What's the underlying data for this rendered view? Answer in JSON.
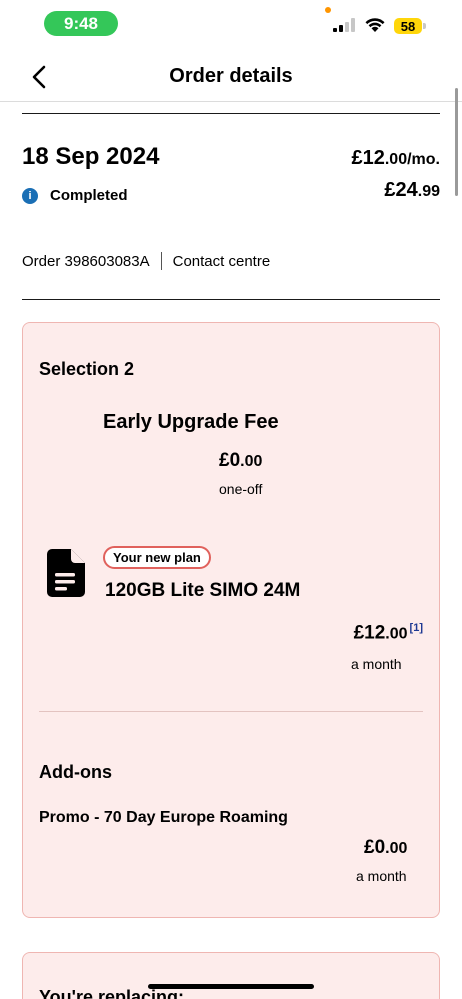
{
  "status_bar": {
    "time": "9:48",
    "battery": "58",
    "colors": {
      "time_pill": "#34c759",
      "battery": "#ffd60a",
      "activity_dot": "#ff9500"
    }
  },
  "nav": {
    "back_icon": "chevron-left-icon",
    "title": "Order details"
  },
  "order": {
    "date": "18 Sep 2024",
    "monthly_price_main": "£12",
    "monthly_price_minor": ".00/mo.",
    "total_price_main": "£24",
    "total_price_minor": ".99",
    "status_icon": "info-icon",
    "status": "Completed",
    "order_number": "Order 398603083A",
    "contact_link": "Contact centre"
  },
  "selection": {
    "title": "Selection 2",
    "fee_title": "Early Upgrade Fee",
    "fee_price_main": "£0",
    "fee_price_minor": ".00",
    "fee_note": "one-off",
    "plan_icon": "document-icon",
    "plan_badge": "Your new plan",
    "plan_name": "120GB Lite SIMO 24M",
    "plan_price_main": "£12",
    "plan_price_minor": ".00",
    "plan_footnote": "[1]",
    "plan_period": "a month"
  },
  "addons": {
    "title": "Add-ons",
    "name": "Promo - 70 Day Europe Roaming",
    "price_main": "£0",
    "price_minor": ".00",
    "period": "a month"
  },
  "replacing": {
    "title": "You're replacing:"
  },
  "theme": {
    "card_background": "#fdeceb",
    "card_border": "#efb6b2",
    "badge_border": "#e0615c",
    "link_blue": "#1f3a93",
    "info_blue": "#1a6fb5"
  }
}
